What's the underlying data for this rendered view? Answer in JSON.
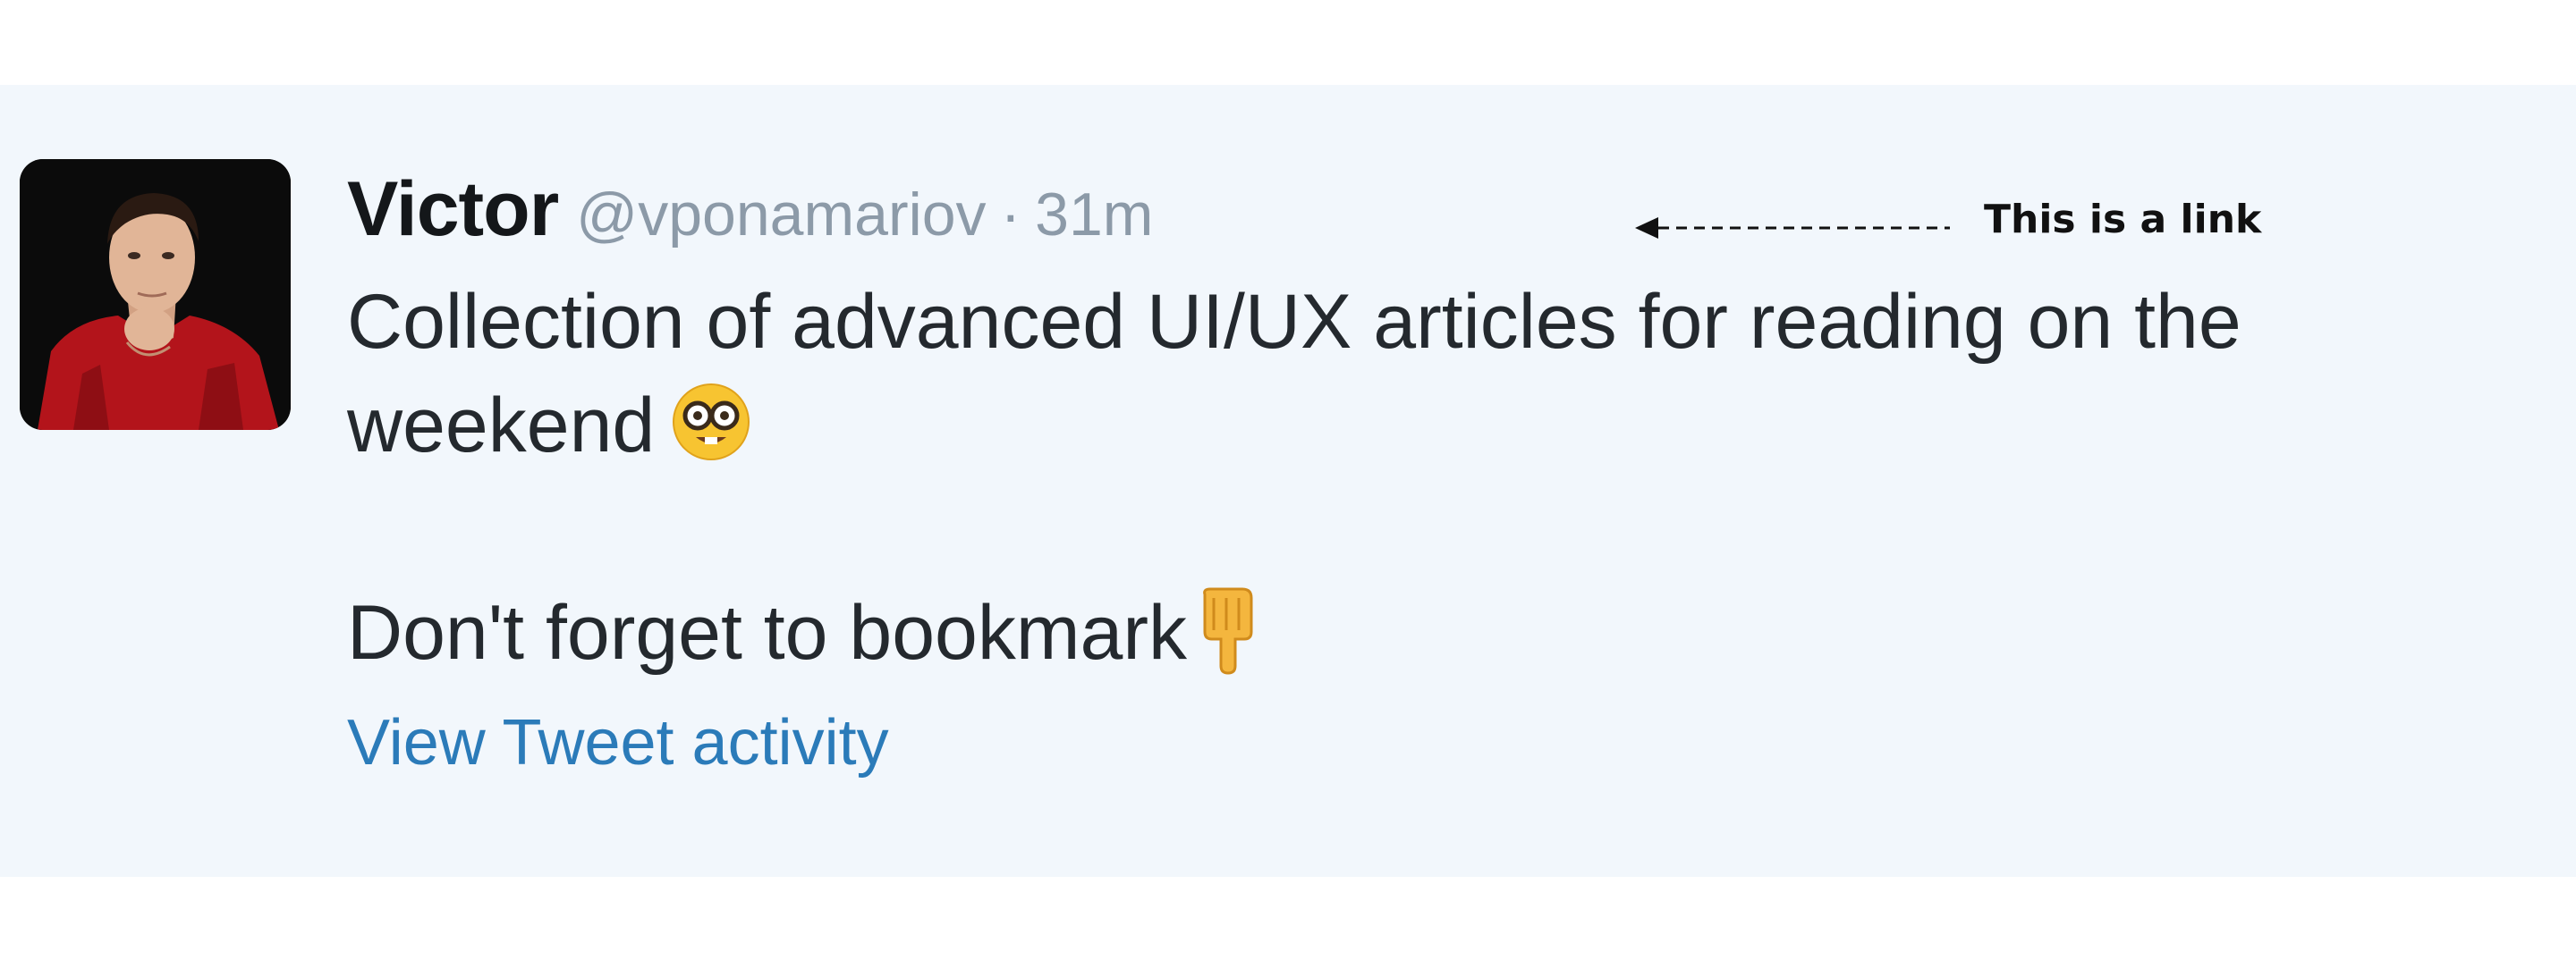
{
  "tweet": {
    "author_name": "Victor",
    "author_handle": "@vponamariov",
    "separator": "·",
    "timestamp": "31m",
    "text_line1": "Collection of advanced UI/UX articles for reading on the",
    "text_line2": "weekend",
    "text_line3": "Don't forget to bookmark",
    "emoji_1": "nerd-face-icon",
    "emoji_2": "pointing-down-icon",
    "activity_link": "View Tweet activity"
  },
  "annotation": {
    "label": "This is a link"
  },
  "colors": {
    "card_background": "#f2f7fc",
    "link_blue": "#2b7bb9",
    "muted_grey": "#8c9aa8",
    "text_dark": "#24292e"
  }
}
